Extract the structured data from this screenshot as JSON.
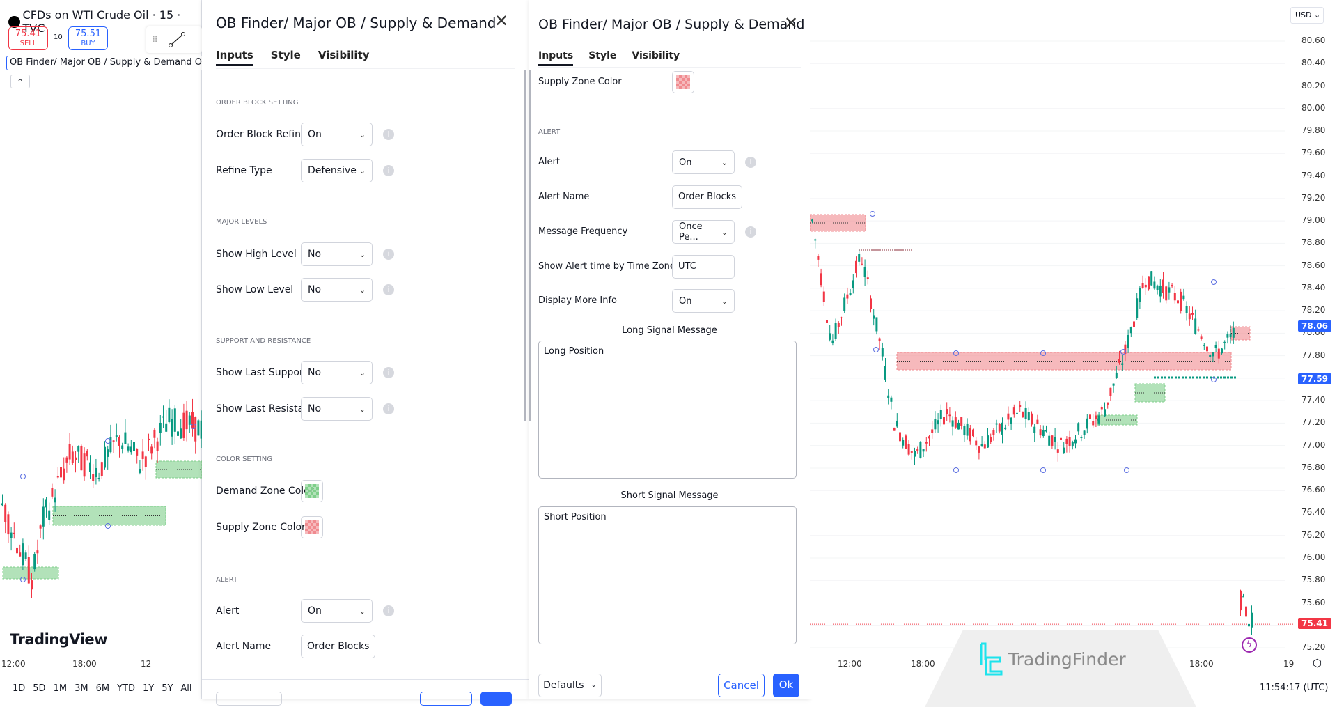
{
  "left_chart": {
    "symbol_title": "CFDs on WTI Crude Oil · 15 · TVC",
    "sell_price": "75.41",
    "sell_label": "SELL",
    "spread": "10",
    "buy_price": "75.51",
    "buy_label": "BUY",
    "indicator_label": "OB Finder/ Major OB / Supply & Demand On I",
    "logo_text": "TradingView",
    "time_labels": [
      "12:00",
      "18:00",
      "12"
    ],
    "ranges": [
      "1D",
      "5D",
      "1M",
      "3M",
      "6M",
      "YTD",
      "1Y",
      "5Y",
      "All"
    ]
  },
  "dialog1": {
    "title": "OB Finder/ Major OB / Supply & Demand",
    "tabs": [
      "Inputs",
      "Style",
      "Visibility"
    ],
    "order_block_section": "ORDER BLOCK SETTING",
    "order_block_refine": {
      "label": "Order Block Refine",
      "value": "On"
    },
    "refine_type": {
      "label": "Refine Type",
      "value": "Defensive"
    },
    "major_section": "MAJOR LEVELS",
    "show_high": {
      "label": "Show High Level",
      "value": "No"
    },
    "show_low": {
      "label": "Show Low Level",
      "value": "No"
    },
    "sr_section": "SUPPORT AND RESISTANCE",
    "show_support": {
      "label": "Show Last Support",
      "value": "No"
    },
    "show_resistance": {
      "label": "Show Last Resistance",
      "value": "No"
    },
    "color_section": "COLOR SETTING",
    "demand_color": {
      "label": "Demand Zone Color",
      "color": "#7fcf8a"
    },
    "supply_color": {
      "label": "Supply Zone Color",
      "color": "#f08a8f"
    },
    "alert_section": "ALERT",
    "alert": {
      "label": "Alert",
      "value": "On"
    },
    "alert_name": {
      "label": "Alert Name",
      "value": "Order Blocks"
    }
  },
  "dialog2": {
    "title": "OB Finder/ Major OB / Supply & Demand",
    "tabs": [
      "Inputs",
      "Style",
      "Visibility"
    ],
    "supply_color": {
      "label": "Supply Zone Color",
      "color": "#f08a8f"
    },
    "alert_section": "ALERT",
    "alert": {
      "label": "Alert",
      "value": "On"
    },
    "alert_name": {
      "label": "Alert Name",
      "value": "Order Blocks"
    },
    "message_frequency": {
      "label": "Message Frequency",
      "value": "Once Pe..."
    },
    "alert_time_zone": {
      "label": "Show Alert time by Time Zone",
      "value": "UTC"
    },
    "display_more_info": {
      "label": "Display More Info",
      "value": "On"
    },
    "long_label": "Long Signal Message",
    "long_value": "Long Position",
    "short_label": "Short Signal Message",
    "short_value": "Short Position",
    "defaults": "Defaults",
    "cancel": "Cancel",
    "ok": "Ok"
  },
  "right_chart": {
    "currency": "USD",
    "price_labels": [
      "80.60",
      "80.40",
      "80.20",
      "80.00",
      "79.80",
      "79.60",
      "79.40",
      "79.20",
      "79.00",
      "78.80",
      "78.60",
      "78.40",
      "78.20",
      "78.00",
      "77.80",
      "77.60",
      "77.40",
      "77.20",
      "77.00",
      "76.80",
      "76.60",
      "76.40",
      "76.20",
      "76.00",
      "75.80",
      "75.60",
      "75.40",
      "75.20"
    ],
    "badges": [
      {
        "value": "78.06",
        "color": "#2962ff"
      },
      {
        "value": "77.59",
        "color": "#2962ff"
      },
      {
        "value": "75.41",
        "color": "#f23645"
      }
    ],
    "time_labels": [
      "12:00",
      "18:00",
      "18:00",
      "19"
    ],
    "clock": "11:54:17 (UTC)",
    "watermark": "TradingFinder",
    "colors": {
      "up": "#089981",
      "down": "#f23645",
      "supply": "#f08a8f",
      "demand": "#7fcf8a",
      "pivot": "#5b6ee1"
    }
  }
}
